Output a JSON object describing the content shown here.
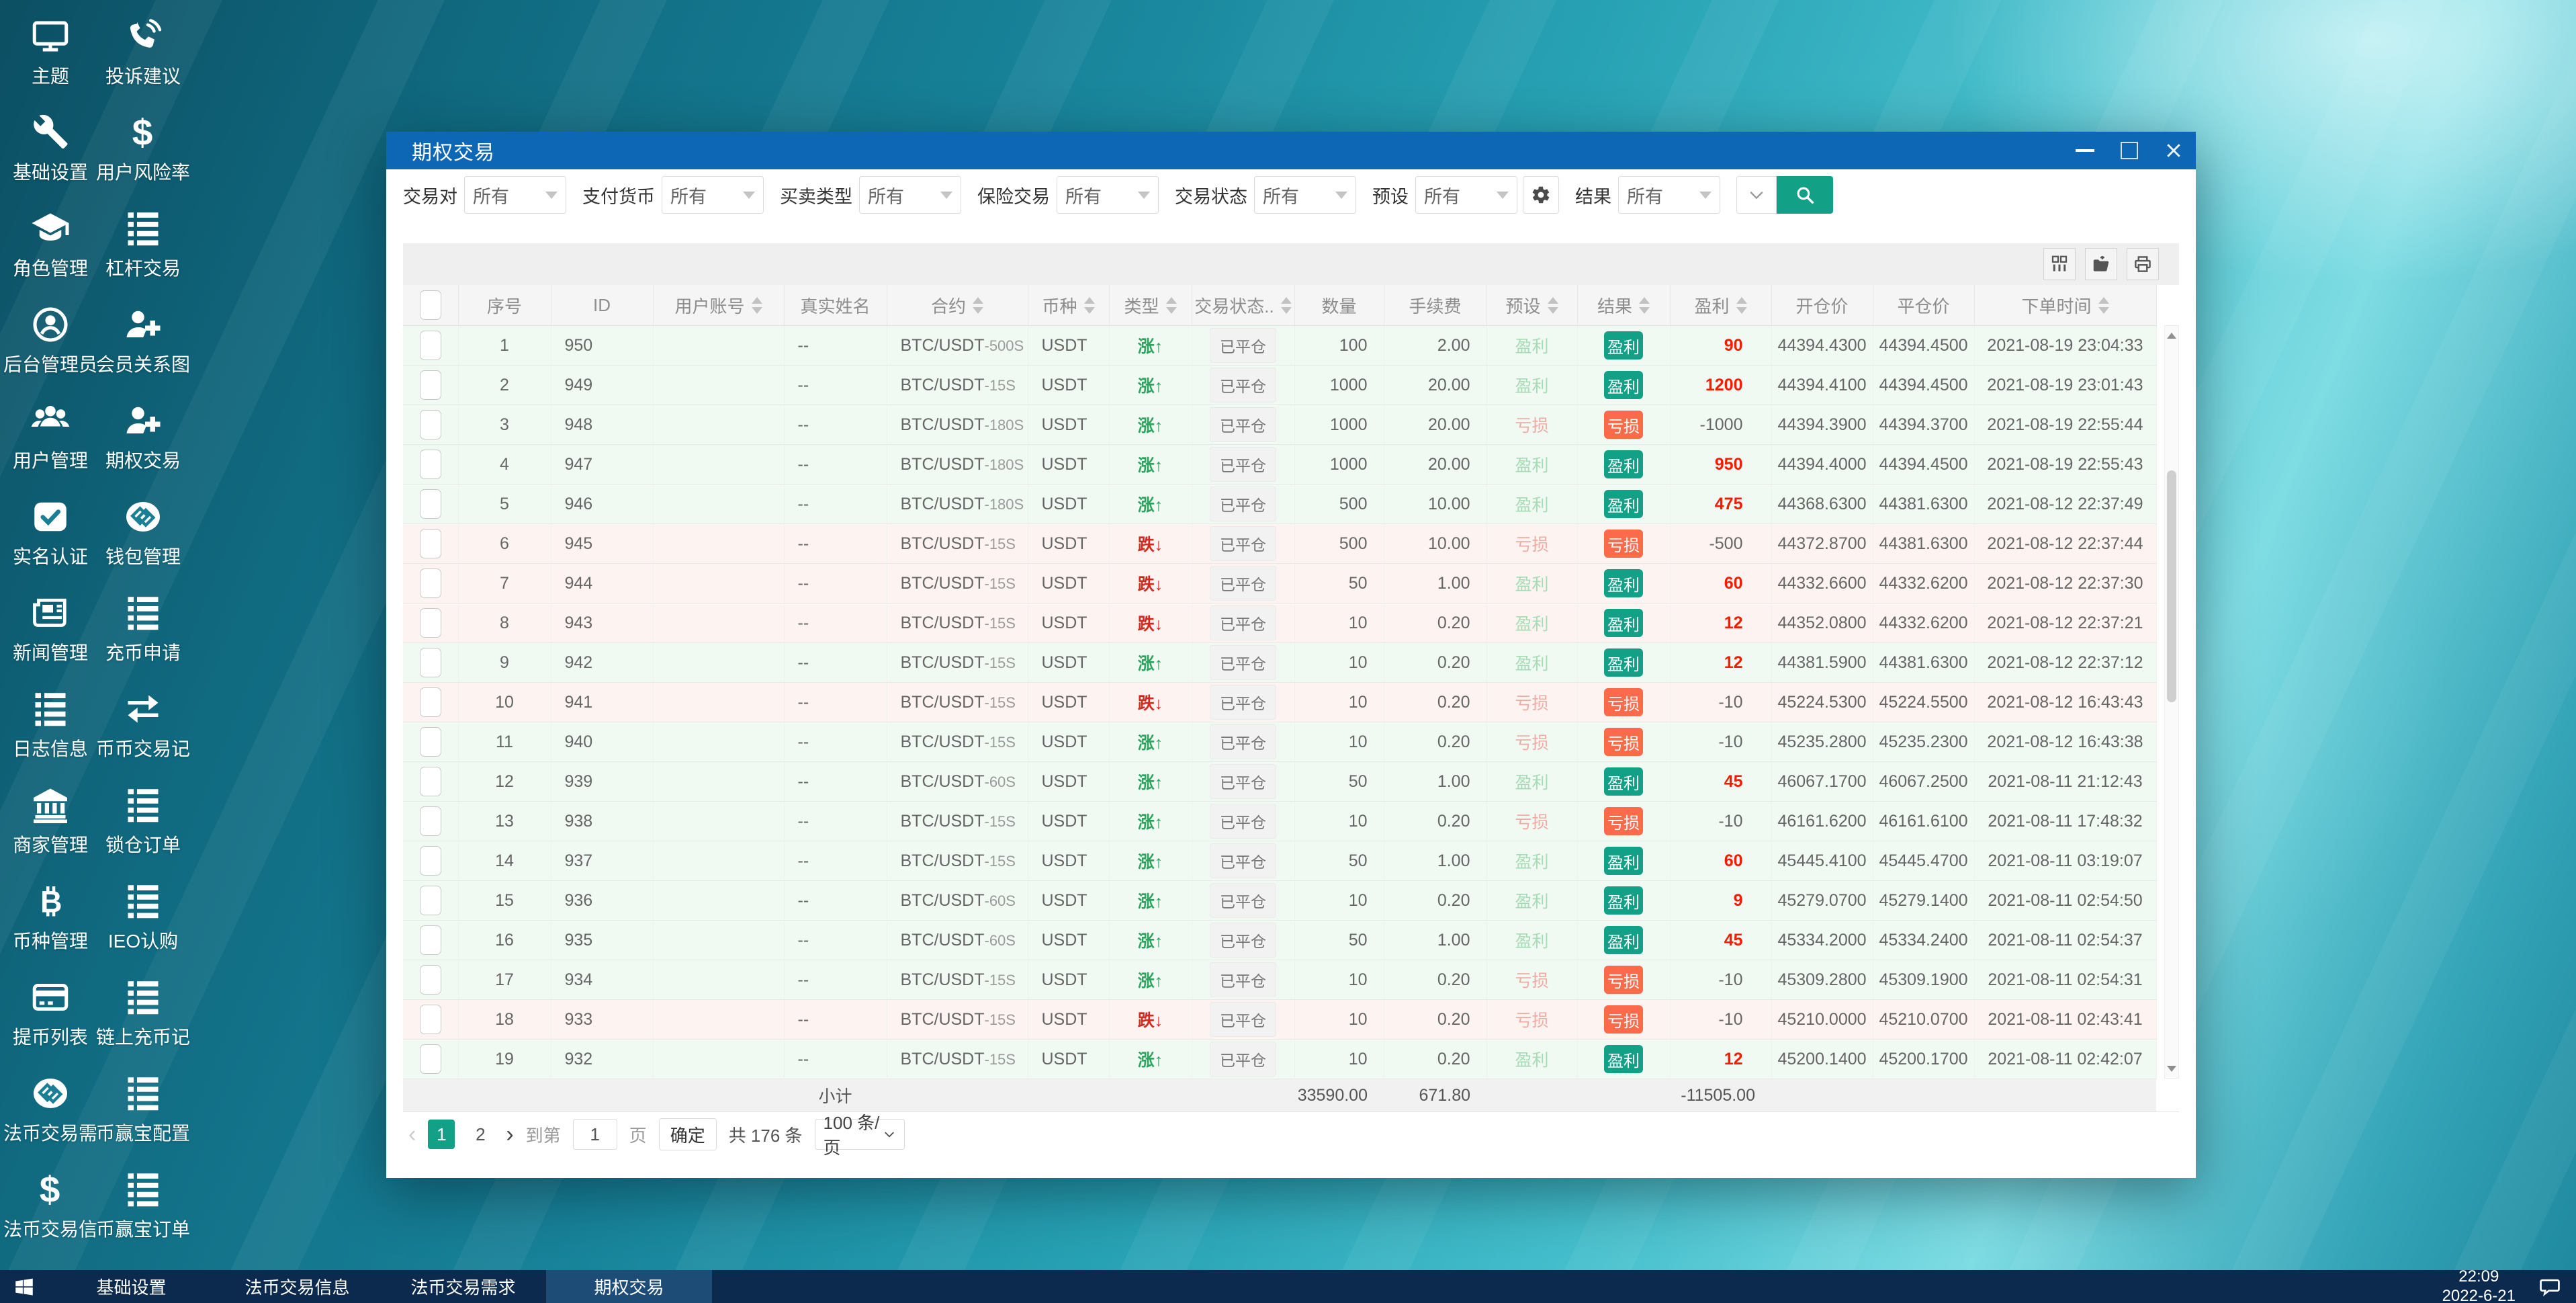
{
  "desktop": {
    "icons": [
      {
        "label": "主题",
        "icon": "monitor"
      },
      {
        "label": "投诉建议",
        "icon": "phone"
      },
      {
        "label": "基础设置",
        "icon": "wrench"
      },
      {
        "label": "用户风险率",
        "icon": "dollar"
      },
      {
        "label": "角色管理",
        "icon": "cap"
      },
      {
        "label": "杠杆交易",
        "icon": "list"
      },
      {
        "label": "后台管理员",
        "icon": "admin"
      },
      {
        "label": "会员关系图",
        "icon": "user-plus"
      },
      {
        "label": "用户管理",
        "icon": "users"
      },
      {
        "label": "期权交易",
        "icon": "user-plus"
      },
      {
        "label": "实名认证",
        "icon": "check"
      },
      {
        "label": "钱包管理",
        "icon": "wallet"
      },
      {
        "label": "新闻管理",
        "icon": "news"
      },
      {
        "label": "充币申请",
        "icon": "list"
      },
      {
        "label": "日志信息",
        "icon": "list"
      },
      {
        "label": "币币交易记",
        "icon": "transfer"
      },
      {
        "label": "商家管理",
        "icon": "bank"
      },
      {
        "label": "锁仓订单",
        "icon": "list"
      },
      {
        "label": "币种管理",
        "icon": "btc"
      },
      {
        "label": "IEO认购",
        "icon": "list"
      },
      {
        "label": "提币列表",
        "icon": "card"
      },
      {
        "label": "链上充币记",
        "icon": "list"
      },
      {
        "label": "法币交易需",
        "icon": "wallet"
      },
      {
        "label": "币赢宝配置",
        "icon": "list"
      },
      {
        "label": "法币交易信",
        "icon": "dollar"
      },
      {
        "label": "币赢宝订单",
        "icon": "list"
      }
    ]
  },
  "window": {
    "title": "期权交易",
    "filters": [
      {
        "label": "交易对",
        "value": "所有"
      },
      {
        "label": "支付货币",
        "value": "所有"
      },
      {
        "label": "买卖类型",
        "value": "所有"
      },
      {
        "label": "保险交易",
        "value": "所有"
      },
      {
        "label": "交易状态",
        "value": "所有"
      },
      {
        "label": "预设",
        "value": "所有",
        "gear_after": true
      },
      {
        "label": "结果",
        "value": "所有"
      }
    ],
    "toolbar_icons": [
      "columns",
      "export",
      "print"
    ],
    "table": {
      "columns": [
        {
          "label": "序号",
          "sortable": false
        },
        {
          "label": "ID",
          "sortable": false
        },
        {
          "label": "用户账号",
          "sortable": true
        },
        {
          "label": "真实姓名",
          "sortable": false
        },
        {
          "label": "合约",
          "sortable": true
        },
        {
          "label": "币种",
          "sortable": true
        },
        {
          "label": "类型",
          "sortable": true
        },
        {
          "label": "交易状态..",
          "sortable": true
        },
        {
          "label": "数量",
          "sortable": false
        },
        {
          "label": "手续费",
          "sortable": false
        },
        {
          "label": "预设",
          "sortable": true
        },
        {
          "label": "结果",
          "sortable": true
        },
        {
          "label": "盈利",
          "sortable": true
        },
        {
          "label": "开仓价",
          "sortable": false
        },
        {
          "label": "平仓价",
          "sortable": false
        },
        {
          "label": "下单时间",
          "sortable": true
        }
      ],
      "rows": [
        {
          "seq": "1",
          "id": "950",
          "account": "",
          "name": "--",
          "contract": "BTC/USDT-500S",
          "coin": "USDT",
          "type": "涨",
          "status": "已平仓",
          "qty": "100",
          "fee": "2.00",
          "preset": "盈利",
          "result": "盈利",
          "profit": "90",
          "open": "44394.4300",
          "close": "44394.4500",
          "time": "2021-08-19 23:04:33"
        },
        {
          "seq": "2",
          "id": "949",
          "account": "",
          "name": "--",
          "contract": "BTC/USDT-15S",
          "coin": "USDT",
          "type": "涨",
          "status": "已平仓",
          "qty": "1000",
          "fee": "20.00",
          "preset": "盈利",
          "result": "盈利",
          "profit": "1200",
          "open": "44394.4100",
          "close": "44394.4500",
          "time": "2021-08-19 23:01:43"
        },
        {
          "seq": "3",
          "id": "948",
          "account": "",
          "name": "--",
          "contract": "BTC/USDT-180S",
          "coin": "USDT",
          "type": "涨",
          "status": "已平仓",
          "qty": "1000",
          "fee": "20.00",
          "preset": "亏损",
          "result": "亏损",
          "profit": "-1000",
          "open": "44394.3900",
          "close": "44394.3700",
          "time": "2021-08-19 22:55:44"
        },
        {
          "seq": "4",
          "id": "947",
          "account": "",
          "name": "--",
          "contract": "BTC/USDT-180S",
          "coin": "USDT",
          "type": "涨",
          "status": "已平仓",
          "qty": "1000",
          "fee": "20.00",
          "preset": "盈利",
          "result": "盈利",
          "profit": "950",
          "open": "44394.4000",
          "close": "44394.4500",
          "time": "2021-08-19 22:55:43"
        },
        {
          "seq": "5",
          "id": "946",
          "account": "",
          "name": "--",
          "contract": "BTC/USDT-180S",
          "coin": "USDT",
          "type": "涨",
          "status": "已平仓",
          "qty": "500",
          "fee": "10.00",
          "preset": "盈利",
          "result": "盈利",
          "profit": "475",
          "open": "44368.6300",
          "close": "44381.6300",
          "time": "2021-08-12 22:37:49"
        },
        {
          "seq": "6",
          "id": "945",
          "account": "",
          "name": "--",
          "contract": "BTC/USDT-15S",
          "coin": "USDT",
          "type": "跌",
          "status": "已平仓",
          "qty": "500",
          "fee": "10.00",
          "preset": "亏损",
          "result": "亏损",
          "profit": "-500",
          "open": "44372.8700",
          "close": "44381.6300",
          "time": "2021-08-12 22:37:44"
        },
        {
          "seq": "7",
          "id": "944",
          "account": "",
          "name": "--",
          "contract": "BTC/USDT-15S",
          "coin": "USDT",
          "type": "跌",
          "status": "已平仓",
          "qty": "50",
          "fee": "1.00",
          "preset": "盈利",
          "result": "盈利",
          "profit": "60",
          "open": "44332.6600",
          "close": "44332.6200",
          "time": "2021-08-12 22:37:30"
        },
        {
          "seq": "8",
          "id": "943",
          "account": "",
          "name": "--",
          "contract": "BTC/USDT-15S",
          "coin": "USDT",
          "type": "跌",
          "status": "已平仓",
          "qty": "10",
          "fee": "0.20",
          "preset": "盈利",
          "result": "盈利",
          "profit": "12",
          "open": "44352.0800",
          "close": "44332.6200",
          "time": "2021-08-12 22:37:21"
        },
        {
          "seq": "9",
          "id": "942",
          "account": "",
          "name": "--",
          "contract": "BTC/USDT-15S",
          "coin": "USDT",
          "type": "涨",
          "status": "已平仓",
          "qty": "10",
          "fee": "0.20",
          "preset": "盈利",
          "result": "盈利",
          "profit": "12",
          "open": "44381.5900",
          "close": "44381.6300",
          "time": "2021-08-12 22:37:12"
        },
        {
          "seq": "10",
          "id": "941",
          "account": "",
          "name": "--",
          "contract": "BTC/USDT-15S",
          "coin": "USDT",
          "type": "跌",
          "status": "已平仓",
          "qty": "10",
          "fee": "0.20",
          "preset": "亏损",
          "result": "亏损",
          "profit": "-10",
          "open": "45224.5300",
          "close": "45224.5500",
          "time": "2021-08-12 16:43:43"
        },
        {
          "seq": "11",
          "id": "940",
          "account": "",
          "name": "--",
          "contract": "BTC/USDT-15S",
          "coin": "USDT",
          "type": "涨",
          "status": "已平仓",
          "qty": "10",
          "fee": "0.20",
          "preset": "亏损",
          "result": "亏损",
          "profit": "-10",
          "open": "45235.2800",
          "close": "45235.2300",
          "time": "2021-08-12 16:43:38"
        },
        {
          "seq": "12",
          "id": "939",
          "account": "",
          "name": "--",
          "contract": "BTC/USDT-60S",
          "coin": "USDT",
          "type": "涨",
          "status": "已平仓",
          "qty": "50",
          "fee": "1.00",
          "preset": "盈利",
          "result": "盈利",
          "profit": "45",
          "open": "46067.1700",
          "close": "46067.2500",
          "time": "2021-08-11 21:12:43"
        },
        {
          "seq": "13",
          "id": "938",
          "account": "",
          "name": "--",
          "contract": "BTC/USDT-15S",
          "coin": "USDT",
          "type": "涨",
          "status": "已平仓",
          "qty": "10",
          "fee": "0.20",
          "preset": "亏损",
          "result": "亏损",
          "profit": "-10",
          "open": "46161.6200",
          "close": "46161.6100",
          "time": "2021-08-11 17:48:32"
        },
        {
          "seq": "14",
          "id": "937",
          "account": "",
          "name": "--",
          "contract": "BTC/USDT-15S",
          "coin": "USDT",
          "type": "涨",
          "status": "已平仓",
          "qty": "50",
          "fee": "1.00",
          "preset": "盈利",
          "result": "盈利",
          "profit": "60",
          "open": "45445.4100",
          "close": "45445.4700",
          "time": "2021-08-11 03:19:07"
        },
        {
          "seq": "15",
          "id": "936",
          "account": "",
          "name": "--",
          "contract": "BTC/USDT-60S",
          "coin": "USDT",
          "type": "涨",
          "status": "已平仓",
          "qty": "10",
          "fee": "0.20",
          "preset": "盈利",
          "result": "盈利",
          "profit": "9",
          "open": "45279.0700",
          "close": "45279.1400",
          "time": "2021-08-11 02:54:50"
        },
        {
          "seq": "16",
          "id": "935",
          "account": "",
          "name": "--",
          "contract": "BTC/USDT-60S",
          "coin": "USDT",
          "type": "涨",
          "status": "已平仓",
          "qty": "50",
          "fee": "1.00",
          "preset": "盈利",
          "result": "盈利",
          "profit": "45",
          "open": "45334.2000",
          "close": "45334.2400",
          "time": "2021-08-11 02:54:37"
        },
        {
          "seq": "17",
          "id": "934",
          "account": "",
          "name": "--",
          "contract": "BTC/USDT-15S",
          "coin": "USDT",
          "type": "涨",
          "status": "已平仓",
          "qty": "10",
          "fee": "0.20",
          "preset": "亏损",
          "result": "亏损",
          "profit": "-10",
          "open": "45309.2800",
          "close": "45309.1900",
          "time": "2021-08-11 02:54:31"
        },
        {
          "seq": "18",
          "id": "933",
          "account": "",
          "name": "--",
          "contract": "BTC/USDT-15S",
          "coin": "USDT",
          "type": "跌",
          "status": "已平仓",
          "qty": "10",
          "fee": "0.20",
          "preset": "亏损",
          "result": "亏损",
          "profit": "-10",
          "open": "45210.0000",
          "close": "45210.0700",
          "time": "2021-08-11 02:43:41"
        },
        {
          "seq": "19",
          "id": "932",
          "account": "",
          "name": "--",
          "contract": "BTC/USDT-15S",
          "coin": "USDT",
          "type": "涨",
          "status": "已平仓",
          "qty": "10",
          "fee": "0.20",
          "preset": "盈利",
          "result": "盈利",
          "profit": "12",
          "open": "45200.1400",
          "close": "45200.1700",
          "time": "2021-08-11 02:42:07"
        }
      ],
      "subtotal": {
        "label": "小计",
        "qty": "33590.00",
        "fee": "671.80",
        "profit": "-11505.00"
      }
    },
    "pagination": {
      "pages": [
        "1",
        "2"
      ],
      "active_page": "1",
      "prev": "‹",
      "next": "›",
      "goto_label": "到第",
      "goto_value": "1",
      "page_unit": "页",
      "confirm_label": "确定",
      "total_label": "共 176 条",
      "page_size": "100 条/页"
    }
  },
  "taskbar": {
    "items": [
      {
        "label": "基础设置",
        "active": false
      },
      {
        "label": "法币交易信息",
        "active": false
      },
      {
        "label": "法币交易需求",
        "active": false
      },
      {
        "label": "期权交易",
        "active": true
      }
    ],
    "time": "22:09",
    "date": "2022-6-21"
  },
  "colors": {
    "accent_teal": "#12a087",
    "accent_orange": "#fb6a4a",
    "profit_red": "#f51c00",
    "type_up_green": "#2da35f",
    "type_down_red": "#d5281e",
    "titlebar_blue": "#0e67b5",
    "taskbar_navy": "#0b2a4e",
    "row_green": "#f0f9f2",
    "row_pink": "#fdf3f1"
  }
}
